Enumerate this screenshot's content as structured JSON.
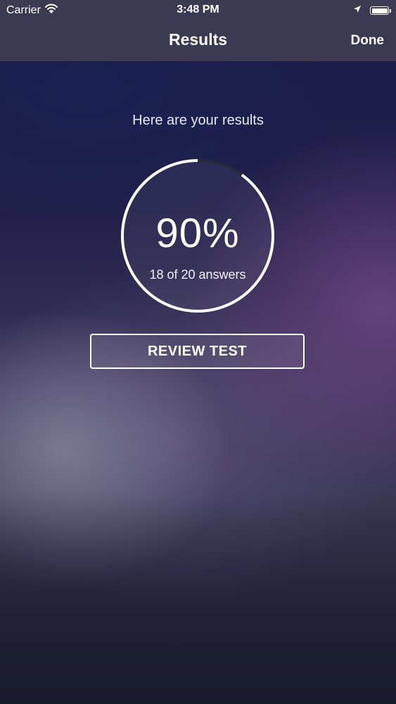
{
  "status_bar": {
    "carrier": "Carrier",
    "time": "3:48 PM",
    "battery_level": 1.0
  },
  "nav": {
    "title": "Results",
    "done_label": "Done"
  },
  "results": {
    "subtitle": "Here are your results",
    "percent_label": "90%",
    "score_fraction": 0.9,
    "answers_label": "18 of 20 answers",
    "review_button_label": "REVIEW TEST"
  },
  "colors": {
    "nav_background": "#3b3a52",
    "ring_complete": "#ffffff",
    "ring_remaining": "#2a2940"
  },
  "icons": {
    "wifi": "wifi-icon",
    "location": "location-arrow-icon",
    "battery": "battery-icon"
  }
}
